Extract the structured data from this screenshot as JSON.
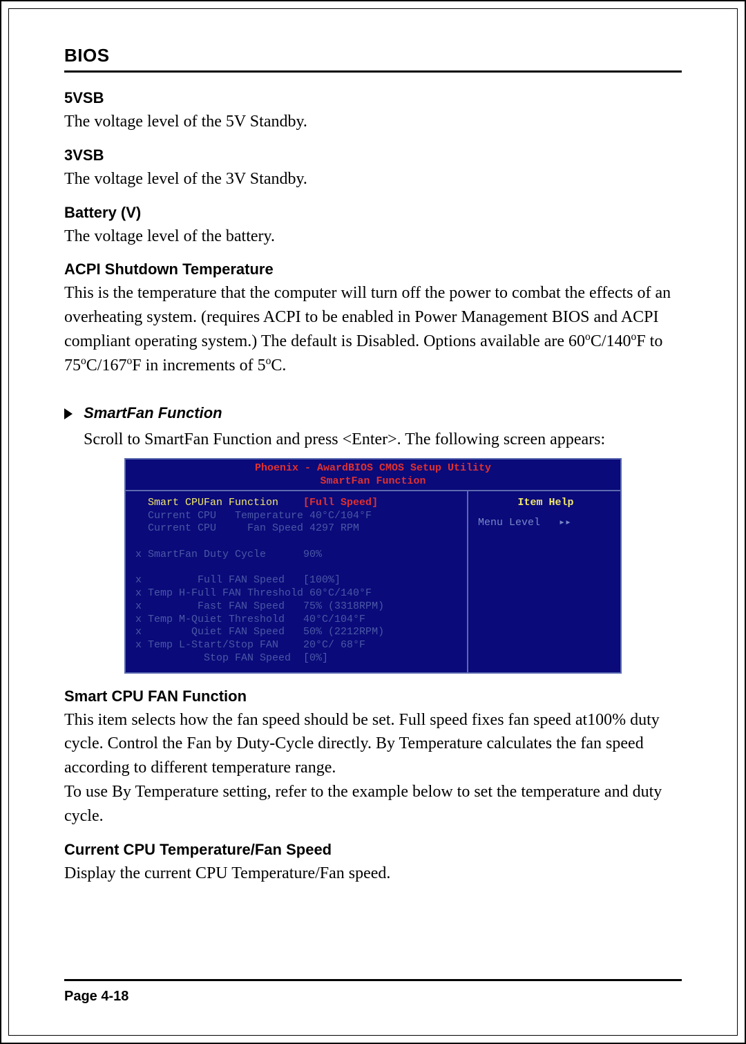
{
  "header": {
    "title": "BIOS"
  },
  "items": {
    "vsb5": {
      "title": "5VSB",
      "body": "The voltage level of the 5V Standby."
    },
    "vsb3": {
      "title": "3VSB",
      "body": "The voltage level of the 3V Standby."
    },
    "battery": {
      "title": "Battery (V)",
      "body": "The voltage level of the battery."
    },
    "acpi": {
      "title": "ACPI Shutdown Temperature",
      "body_prefix": "This is the temperature that the computer will turn off the power to combat the effects of an overheating system. (requires ACPI to be enabled in Power Management BIOS and ACPI compliant operating system.) The default is Disabled. Options available are 60",
      "deg1": "o",
      "body_mid1": "C/140",
      "deg2": "o",
      "body_mid2": "F to 75",
      "deg3": "o",
      "body_mid3": "C/167",
      "deg4": "o",
      "body_mid4": "F in increments of 5",
      "deg5": "o",
      "body_suffix": "C."
    }
  },
  "smartfan": {
    "heading": "SmartFan Function",
    "intro": "Scroll to SmartFan Function and press <Enter>. The following screen appears:"
  },
  "bios_screen": {
    "header_line1": "Phoenix - AwardBIOS CMOS Setup Utility",
    "header_line2": "SmartFan Function",
    "right": {
      "help_title": "Item Help",
      "menu_level_label": "Menu Level",
      "menu_level_marker": "▸▸"
    },
    "left": {
      "r1_label": "  Smart CPUFan Function    ",
      "r1_value": "[Full Speed]",
      "r2_label": "  Current CPU   Temperature ",
      "r2_value": "40°C/104°F",
      "r3_label": "  Current CPU     Fan Speed ",
      "r3_value": "4297 RPM",
      "blank1": " ",
      "r4_label": "x SmartFan Duty Cycle      ",
      "r4_value": "90%",
      "blank2": " ",
      "r5_label": "x         Full FAN Speed   ",
      "r5_value": "[100%]",
      "r6_label": "x Temp H-Full FAN Threshold ",
      "r6_value": "60°C/140°F",
      "r7_label": "x         Fast FAN Speed   ",
      "r7_value": "75% (3318RPM)",
      "r8_label": "x Temp M-Quiet Threshold   ",
      "r8_value": "40°C/104°F",
      "r9_label": "x        Quiet FAN Speed   ",
      "r9_value": "50% (2212RPM)",
      "r10_label": "x Temp L-Start/Stop FAN    ",
      "r10_value": "20°C/ 68°F",
      "r11_label": "           Stop FAN Speed  ",
      "r11_value": "[0%]"
    }
  },
  "post": {
    "smart_cpu_fan": {
      "title": "Smart CPU FAN Function",
      "body": "This item selects how the fan speed should be set. Full speed fixes fan speed at100% duty cycle. Control the Fan by Duty-Cycle directly. By Temperature calculates the fan speed according to different temperature range.\nTo use By Temperature setting, refer to the example below to set the temperature and duty cycle."
    },
    "current_cpu": {
      "title": "Current CPU Temperature/Fan Speed",
      "body": "Display the current CPU Temperature/Fan speed."
    }
  },
  "footer": {
    "page": "Page 4-18"
  }
}
